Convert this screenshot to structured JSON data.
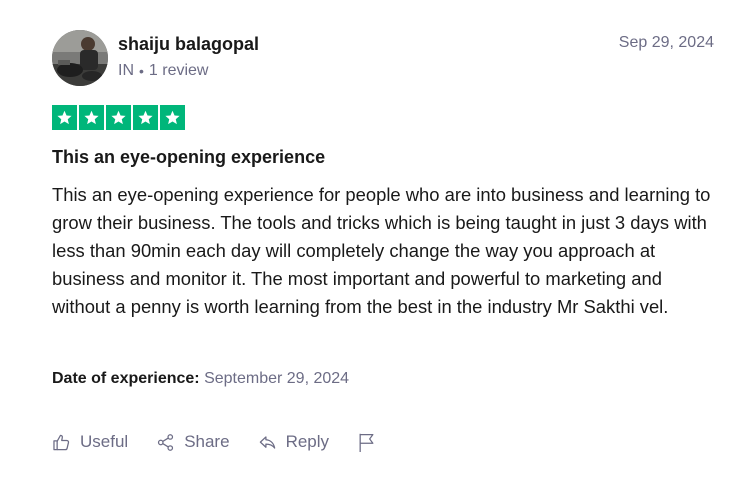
{
  "review": {
    "reviewer_name": "shaiju balagopal",
    "country": "IN",
    "review_count": "1 review",
    "date": "Sep 29, 2024",
    "rating": 5,
    "title": "This an eye-opening experience",
    "body": "This an eye-opening experience for people who are into business and learning to grow their business. The tools and tricks which is being taught in just 3 days with less than 90min each day will completely change the way you approach at business and monitor it. The most important and powerful to marketing and without a penny is worth learning from the best in the industry Mr Sakthi vel.",
    "experience_label": "Date of experience:",
    "experience_date": "September 29, 2024"
  },
  "actions": {
    "useful_label": "Useful",
    "share_label": "Share",
    "reply_label": "Reply"
  },
  "icons": {
    "star": "star-icon",
    "useful": "thumbs-up-icon",
    "share": "share-icon",
    "reply": "reply-icon",
    "flag": "flag-icon"
  },
  "colors": {
    "star_background": "#00b67a",
    "muted_text": "#6c6c85",
    "primary_text": "#191919"
  }
}
